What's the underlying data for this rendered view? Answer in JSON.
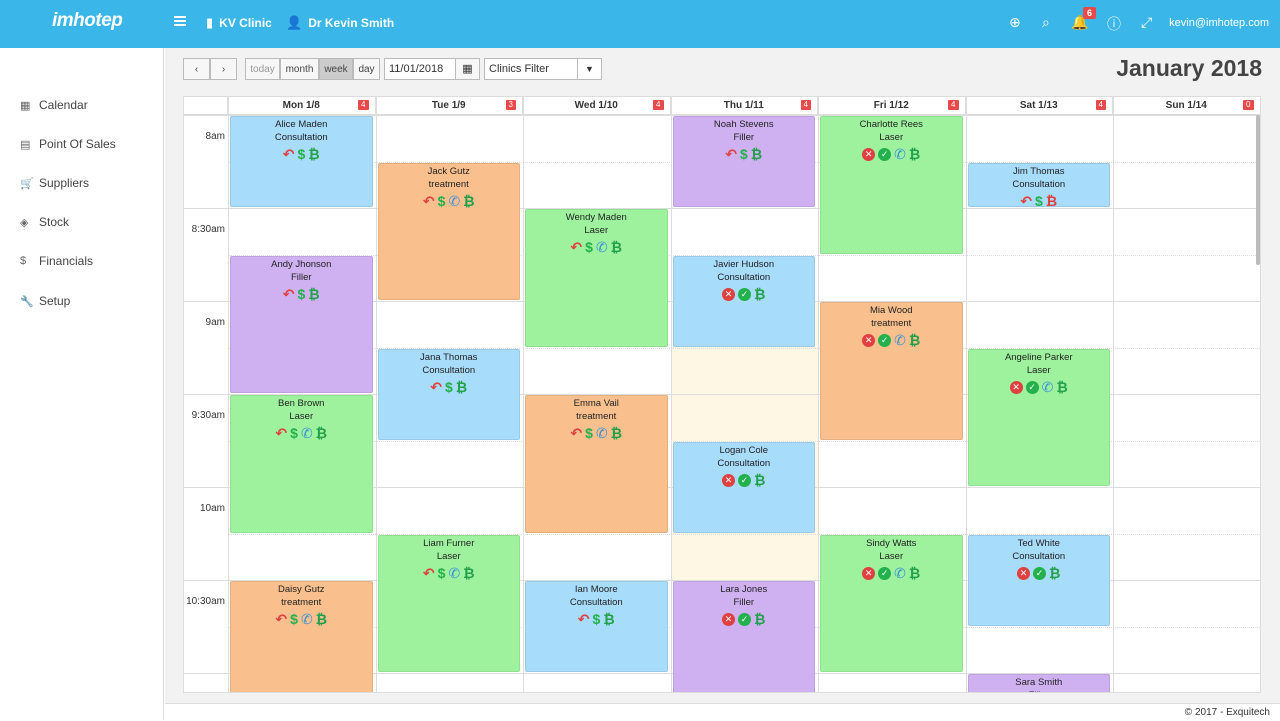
{
  "topbar": {
    "logo": "imhotep",
    "clinic": "KV Clinic",
    "doctor": "Dr Kevin Smith",
    "notifications": "6",
    "email": "kevin@imhotep.com"
  },
  "sidebar": {
    "items": [
      {
        "label": "Calendar",
        "icon": "calendar-icon"
      },
      {
        "label": "Point Of Sales",
        "icon": "register-icon"
      },
      {
        "label": "Suppliers",
        "icon": "cart-icon"
      },
      {
        "label": "Stock",
        "icon": "layers-icon"
      },
      {
        "label": "Financials",
        "icon": "dollar-icon"
      },
      {
        "label": "Setup",
        "icon": "wrench-icon"
      }
    ]
  },
  "toolbar": {
    "today": "today",
    "month": "month",
    "week": "week",
    "day": "day",
    "date": "11/01/2018",
    "filter": "Clinics Filter",
    "title": "January 2018"
  },
  "days": [
    {
      "label": "Mon 1/8",
      "count": "4"
    },
    {
      "label": "Tue 1/9",
      "count": "3"
    },
    {
      "label": "Wed 1/10",
      "count": "4"
    },
    {
      "label": "Thu 1/11",
      "count": "4"
    },
    {
      "label": "Fri 1/12",
      "count": "4"
    },
    {
      "label": "Sat 1/13",
      "count": "4"
    },
    {
      "label": "Sun 1/14",
      "count": "0"
    }
  ],
  "times": [
    "8am",
    "8:30am",
    "9am",
    "9:30am",
    "10am",
    "10:30am"
  ],
  "events": [
    {
      "day": 0,
      "start": 0,
      "len": 2,
      "name": "Alice Maden",
      "type": "Consultation",
      "color": "blue",
      "icons": [
        "undo",
        "dollar",
        "btc"
      ]
    },
    {
      "day": 0,
      "start": 3,
      "len": 3,
      "name": "Andy Jhonson",
      "type": "Filler",
      "color": "purple",
      "icons": [
        "undo",
        "dollar",
        "btc"
      ]
    },
    {
      "day": 0,
      "start": 6,
      "len": 3,
      "name": "Ben Brown",
      "type": "Laser",
      "color": "green",
      "icons": [
        "undo",
        "dollar",
        "phone",
        "btc"
      ]
    },
    {
      "day": 0,
      "start": 10,
      "len": 3,
      "name": "Daisy Gutz",
      "type": "treatment",
      "color": "orange",
      "icons": [
        "undo",
        "dollar",
        "phone",
        "btc"
      ]
    },
    {
      "day": 1,
      "start": 1,
      "len": 3,
      "name": "Jack Gutz",
      "type": "treatment",
      "color": "orange",
      "icons": [
        "undo",
        "dollar",
        "phone",
        "btc"
      ]
    },
    {
      "day": 1,
      "start": 5,
      "len": 2,
      "name": "Jana Thomas",
      "type": "Consultation",
      "color": "blue",
      "icons": [
        "undo",
        "dollar",
        "btc"
      ]
    },
    {
      "day": 1,
      "start": 9,
      "len": 3,
      "name": "Liam Furner",
      "type": "Laser",
      "color": "green",
      "icons": [
        "undo",
        "dollar",
        "phone",
        "btc"
      ]
    },
    {
      "day": 2,
      "start": 2,
      "len": 3,
      "name": "Wendy Maden",
      "type": "Laser",
      "color": "green",
      "icons": [
        "undo",
        "dollar",
        "phone",
        "btc"
      ]
    },
    {
      "day": 2,
      "start": 6,
      "len": 3,
      "name": "Emma Vail",
      "type": "treatment",
      "color": "orange",
      "icons": [
        "undo",
        "dollar",
        "phone",
        "btc"
      ]
    },
    {
      "day": 2,
      "start": 10,
      "len": 2,
      "name": "Ian Moore",
      "type": "Consultation",
      "color": "blue",
      "icons": [
        "undo",
        "dollar",
        "btc"
      ]
    },
    {
      "day": 3,
      "start": 0,
      "len": 2,
      "name": "Noah Stevens",
      "type": "Filler",
      "color": "purple",
      "icons": [
        "undo",
        "dollar",
        "btc"
      ]
    },
    {
      "day": 3,
      "start": 3,
      "len": 2,
      "name": "Javier Hudson",
      "type": "Consultation",
      "color": "blue",
      "icons": [
        "x",
        "ok",
        "btc"
      ]
    },
    {
      "day": 3,
      "start": 7,
      "len": 2,
      "name": "Logan Cole",
      "type": "Consultation",
      "color": "blue",
      "icons": [
        "x",
        "ok",
        "btc"
      ]
    },
    {
      "day": 3,
      "start": 10,
      "len": 3,
      "name": "Lara Jones",
      "type": "Filler",
      "color": "purple",
      "icons": [
        "x",
        "ok",
        "btc"
      ]
    },
    {
      "day": 4,
      "start": 0,
      "len": 3,
      "name": "Charlotte Rees",
      "type": "Laser",
      "color": "green",
      "icons": [
        "x",
        "ok",
        "phone",
        "btc"
      ]
    },
    {
      "day": 4,
      "start": 4,
      "len": 3,
      "name": "Mia Wood",
      "type": "treatment",
      "color": "orange",
      "icons": [
        "x",
        "ok",
        "phone",
        "btc"
      ]
    },
    {
      "day": 4,
      "start": 9,
      "len": 3,
      "name": "Sindy Watts",
      "type": "Laser",
      "color": "green",
      "icons": [
        "x",
        "ok",
        "phone",
        "btc"
      ]
    },
    {
      "day": 5,
      "start": 1,
      "len": 1,
      "name": "Jim Thomas",
      "type": "Consultation",
      "color": "blue",
      "icons": [
        "undo",
        "dollar",
        "btc-red"
      ]
    },
    {
      "day": 5,
      "start": 5,
      "len": 3,
      "name": "Angeline Parker",
      "type": "Laser",
      "color": "green",
      "icons": [
        "x",
        "ok",
        "phone",
        "btc"
      ]
    },
    {
      "day": 5,
      "start": 9,
      "len": 2,
      "name": "Ted White",
      "type": "Consultation",
      "color": "blue",
      "icons": [
        "x",
        "ok",
        "btc"
      ]
    },
    {
      "day": 5,
      "start": 12,
      "len": 1,
      "name": "Sara Smith",
      "type": "Filler",
      "color": "purple",
      "icons": []
    }
  ],
  "footer": "© 2017 - Exquitech",
  "colors": {
    "topbar": "#3bb6e8",
    "blue": "#a8dcfb",
    "orange": "#f9c08e",
    "purple": "#cfb0f0",
    "green": "#9ef29e",
    "badge": "#e84a4a"
  }
}
